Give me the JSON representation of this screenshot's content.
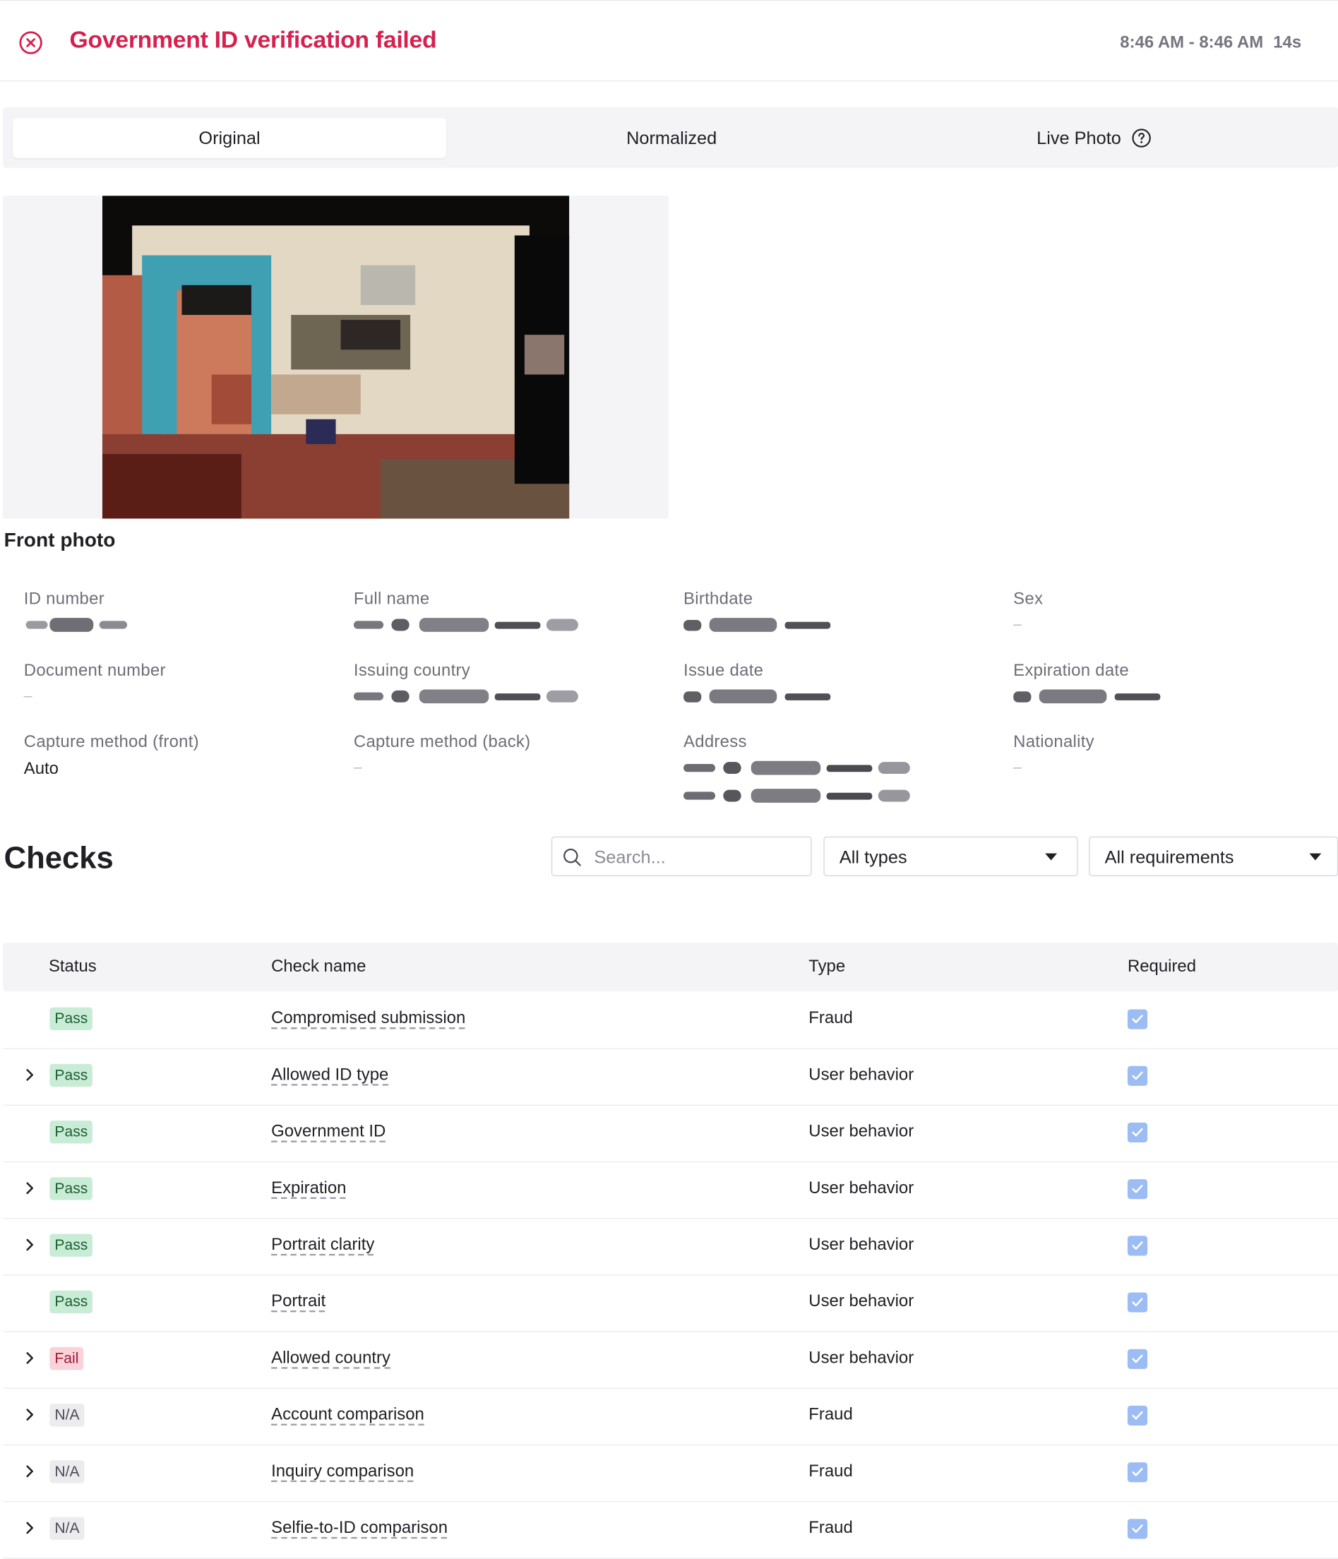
{
  "header": {
    "title": "Government ID verification failed",
    "time_range": "8:46 AM - 8:46 AM",
    "duration": "14s"
  },
  "tabs": [
    {
      "label": "Original",
      "active": true
    },
    {
      "label": "Normalized",
      "active": false
    },
    {
      "label": "Live Photo",
      "active": false,
      "icon": "help-icon"
    }
  ],
  "photo": {
    "caption": "Front photo"
  },
  "fields": {
    "id_number": {
      "label": "ID number"
    },
    "full_name": {
      "label": "Full name"
    },
    "birthdate": {
      "label": "Birthdate"
    },
    "sex": {
      "label": "Sex",
      "value": "–"
    },
    "document_number": {
      "label": "Document number",
      "value": "–"
    },
    "issuing_country": {
      "label": "Issuing country"
    },
    "issue_date": {
      "label": "Issue date"
    },
    "expiration_date": {
      "label": "Expiration date"
    },
    "capture_front": {
      "label": "Capture method (front)",
      "value": "Auto"
    },
    "capture_back": {
      "label": "Capture method (back)",
      "value": "–"
    },
    "address": {
      "label": "Address"
    },
    "nationality": {
      "label": "Nationality",
      "value": "–"
    }
  },
  "checks": {
    "title": "Checks",
    "search_placeholder": "Search...",
    "type_filter": "All types",
    "requirement_filter": "All requirements",
    "columns": {
      "status": "Status",
      "name": "Check name",
      "type": "Type",
      "required": "Required"
    },
    "rows": [
      {
        "status": "Pass",
        "name": "Compromised submission",
        "type": "Fraud",
        "expandable": false,
        "required": true
      },
      {
        "status": "Pass",
        "name": "Allowed ID type",
        "type": "User behavior",
        "expandable": true,
        "required": true
      },
      {
        "status": "Pass",
        "name": "Government ID",
        "type": "User behavior",
        "expandable": false,
        "required": true
      },
      {
        "status": "Pass",
        "name": "Expiration",
        "type": "User behavior",
        "expandable": true,
        "required": true
      },
      {
        "status": "Pass",
        "name": "Portrait clarity",
        "type": "User behavior",
        "expandable": true,
        "required": true
      },
      {
        "status": "Pass",
        "name": "Portrait",
        "type": "User behavior",
        "expandable": false,
        "required": true
      },
      {
        "status": "Fail",
        "name": "Allowed country",
        "type": "User behavior",
        "expandable": true,
        "required": true
      },
      {
        "status": "N/A",
        "name": "Account comparison",
        "type": "Fraud",
        "expandable": true,
        "required": true
      },
      {
        "status": "N/A",
        "name": "Inquiry comparison",
        "type": "Fraud",
        "expandable": true,
        "required": true
      },
      {
        "status": "N/A",
        "name": "Selfie-to-ID comparison",
        "type": "Fraud",
        "expandable": true,
        "required": true
      }
    ]
  },
  "colors": {
    "error": "#d6204f",
    "pass_bg": "#c9ecd6",
    "fail_bg": "#fbd2da",
    "na_bg": "#ececef",
    "checkbox": "#9cbcf4"
  }
}
